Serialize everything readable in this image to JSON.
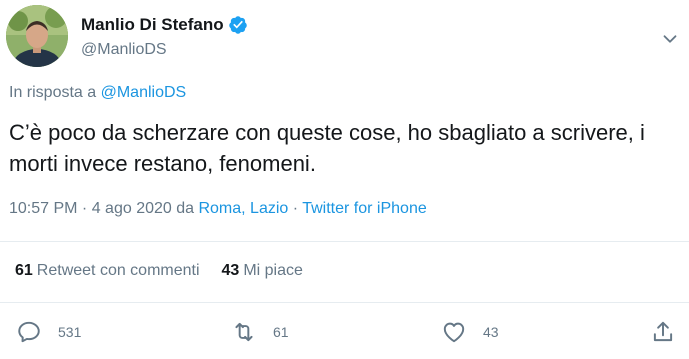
{
  "author": {
    "display_name": "Manlio Di Stefano",
    "handle": "@ManlioDS",
    "verified": true
  },
  "reply_to": {
    "prefix": "In risposta a",
    "mention": "@ManlioDS"
  },
  "tweet": {
    "text": "C’è poco da scherzare con queste cose, ho sbagliato a scrivere, i morti invece restano, fenomeni."
  },
  "meta": {
    "time": "10:57 PM",
    "separator1": " · ",
    "date": "4 ago 2020",
    "location_prefix": " da ",
    "location": "Roma, Lazio",
    "separator2": " · ",
    "source": "Twitter for iPhone"
  },
  "stats": {
    "retweets_count": "61",
    "retweets_label": "Retweet con commenti",
    "likes_count": "43",
    "likes_label": "Mi piace"
  },
  "actions": {
    "reply_count": "531",
    "retweet_count": "61",
    "like_count": "43"
  },
  "icons": {
    "verified": "verified-badge-icon",
    "more": "chevron-down-icon",
    "reply": "reply-icon",
    "retweet": "retweet-icon",
    "like": "heart-icon",
    "share": "share-icon"
  },
  "colors": {
    "link": "#1b95e0",
    "secondary_text": "#657786",
    "primary_text": "#14171a",
    "divider": "#e6ecf0"
  }
}
